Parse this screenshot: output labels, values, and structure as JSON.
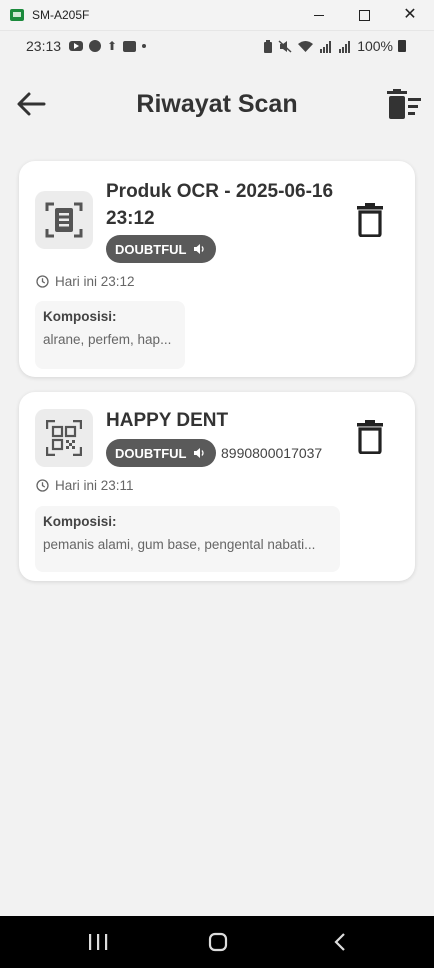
{
  "window": {
    "title": "SM-A205F",
    "app_icon": "android-device-icon"
  },
  "status_bar": {
    "time": "23:13",
    "left_icons": [
      "youtube-icon",
      "account-icon",
      "upload-icon",
      "app-notification-icon",
      "more-dot-icon"
    ],
    "right_icons": [
      "battery-saver-icon",
      "mute-icon",
      "wifi-icon",
      "signal-icon",
      "signal-icon"
    ],
    "battery": "100%"
  },
  "app_bar": {
    "title": "Riwayat Scan",
    "back_icon": "arrow-back-icon",
    "clear_icon": "delete-sweep-icon"
  },
  "history": [
    {
      "title": "Produk OCR - 2025-06-16 23:12",
      "type_icon": "document-scanner-icon",
      "status": "DOUBTFUL",
      "barcode": "",
      "timestamp": "Hari ini 23:12",
      "composition_label": "Komposisi:",
      "composition": "alrane, perfem, hap..."
    },
    {
      "title": "HAPPY DENT",
      "type_icon": "qr-code-icon",
      "status": "DOUBTFUL",
      "barcode": "8990800017037",
      "timestamp": "Hari ini 23:11",
      "composition_label": "Komposisi:",
      "composition": "pemanis alami, gum base, pengental nabati..."
    }
  ],
  "colors": {
    "background": "#f2f2f2",
    "card": "#ffffff",
    "badge": "#5a5a5a",
    "text_primary": "#333333",
    "navbar": "#000000"
  }
}
